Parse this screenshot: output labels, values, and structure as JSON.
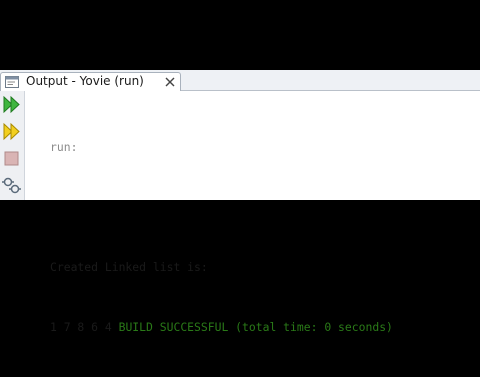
{
  "tab": {
    "title": "Output - Yovie (run)",
    "close_icon": "close-icon",
    "tab_icon": "output-window-icon"
  },
  "toolbar": {
    "items": [
      {
        "icon": "rerun-icon",
        "color": "#2e9e2e"
      },
      {
        "icon": "rerun-with-options-icon",
        "color": "#e0b400"
      },
      {
        "icon": "stop-icon",
        "color": "#c9a0a0"
      },
      {
        "icon": "settings-icon",
        "color": "#5a6a7a"
      }
    ]
  },
  "output": {
    "run_label": "run:",
    "heading": "Created Linked list is:",
    "values": "1 7 8 6 4",
    "build_status": "BUILD SUCCESSFUL (total time: 0 seconds)"
  },
  "colors": {
    "background": "#000000",
    "panel": "#ffffff",
    "success_text": "#2a7a18",
    "muted_text": "#8c8c8c"
  }
}
